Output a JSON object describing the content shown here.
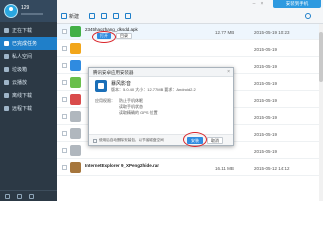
{
  "sidebar": {
    "user": {
      "name": "129"
    },
    "items": [
      {
        "label": "正在下载"
      },
      {
        "label": "已完成任务"
      },
      {
        "label": "私人空间"
      },
      {
        "label": "垃圾箱"
      },
      {
        "label": "云播放"
      },
      {
        "label": "离线下载"
      },
      {
        "label": "远程下载"
      }
    ]
  },
  "toolbar": {
    "new_label": "新建",
    "search_icon": "search-icon",
    "install_phone_label": "安装到手机"
  },
  "files": [
    {
      "name": "2345haozhang_dksdd.apk",
      "size": "12.77 MB",
      "date": "2015-05-19 10:23",
      "icon_color": "#43b047",
      "selected": true,
      "actions": [
        "打开",
        "目录"
      ]
    },
    {
      "name": "",
      "size": "",
      "date": "2015-05-19",
      "icon_color": "#f2a61a",
      "selected": false
    },
    {
      "name": "",
      "size": "",
      "date": "2015-05-19",
      "icon_color": "#2f8be0",
      "selected": false
    },
    {
      "name": "",
      "size": "",
      "date": "2015-05-19",
      "icon_color": "#6abf4b",
      "selected": false
    },
    {
      "name": "",
      "size": "",
      "date": "2015-05-19",
      "icon_color": "#d94b4b",
      "selected": false
    },
    {
      "name": "",
      "size": "",
      "date": "2015-05-19",
      "icon_color": "#b0b7be",
      "selected": false
    },
    {
      "name": "",
      "size": "",
      "date": "2015-05-19",
      "icon_color": "#b0b7be",
      "selected": false
    },
    {
      "name": "",
      "size": "",
      "date": "2015-05-19",
      "icon_color": "#b0b7be",
      "selected": false
    },
    {
      "name": "InternetExplorer 9_XPeng2hide.rar",
      "size": "16.11 MB",
      "date": "2015-05-12 14:12",
      "icon_color": "#a6763c",
      "selected": false
    }
  ],
  "dialog": {
    "title": "腾讯安卓应用安装器",
    "app_name": "暴风影音",
    "app_meta": "版本：5.0.40  大小：12.77MB  要求：Android2.2",
    "perm_head": "应用权限：",
    "permissions": [
      "防止手机休眠",
      "读取手机状态",
      "读取精确的 GPS 位置"
    ],
    "checkbox_label": "使用后自动删除安装包，以节省磁盘空间",
    "ok_label": "安装",
    "cancel_label": "取消"
  },
  "colors": {
    "sidebar_bg": "#2c3945",
    "accent": "#1f7fc9",
    "highlight_oval": "#d9242a"
  }
}
